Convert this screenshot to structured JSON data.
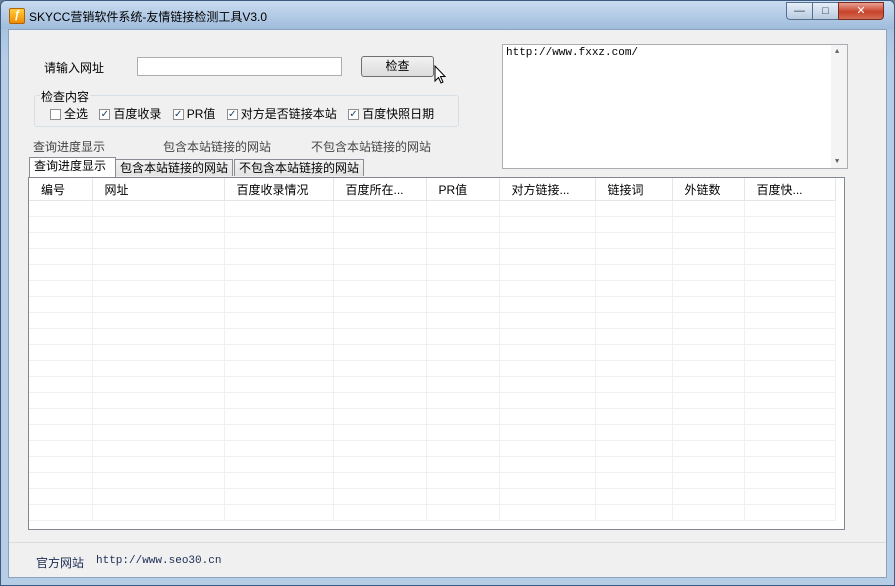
{
  "window": {
    "title": "SKYCC营销软件系统-友情链接检测工具V3.0",
    "minimize_glyph": "—",
    "maximize_glyph": "□",
    "close_glyph": "✕"
  },
  "form": {
    "url_label": "请输入网址",
    "url_value": "",
    "check_button": "检查",
    "group_title": "检查内容",
    "options": [
      {
        "label": "全选",
        "checked": false
      },
      {
        "label": "百度收录",
        "checked": true
      },
      {
        "label": "PR值",
        "checked": true
      },
      {
        "label": "对方是否链接本站",
        "checked": true
      },
      {
        "label": "百度快照日期",
        "checked": true
      }
    ],
    "textarea_value": "http://www.fxxz.com/"
  },
  "progress_labels": {
    "query_progress": "查询进度显示",
    "containing_sites": "包含本站链接的网站",
    "not_containing_sites": "不包含本站链接的网站"
  },
  "tabs": [
    {
      "label": "查询进度显示",
      "active": true
    },
    {
      "label": "包含本站链接的网站",
      "active": false
    },
    {
      "label": "不包含本站链接的网站",
      "active": false
    }
  ],
  "table": {
    "columns": [
      "编号",
      "网址",
      "百度收录情况",
      "百度所在...",
      "PR值",
      "对方链接...",
      "链接词",
      "外链数",
      "百度快..."
    ],
    "rows": []
  },
  "footer": {
    "official_site_label": "官方网站",
    "official_site_url": "http://www.seo30.cn"
  },
  "icons": {
    "app": "lightning-app-icon",
    "cursor": "mouse-pointer-icon",
    "checkbox_mark": "✓"
  }
}
